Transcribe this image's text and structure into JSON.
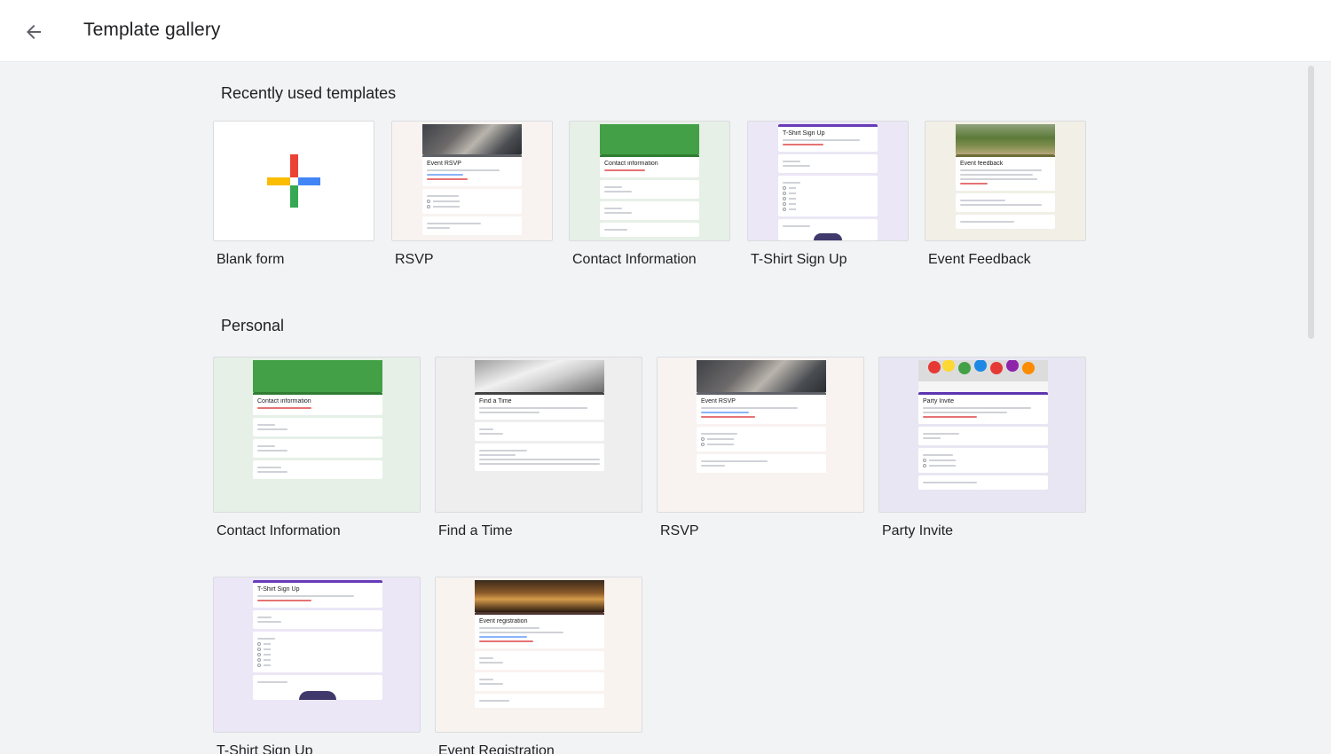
{
  "header": {
    "title": "Template gallery",
    "back_icon": "arrow-back-icon"
  },
  "sections": [
    {
      "title": "Recently used templates",
      "templates": [
        {
          "label": "Blank form"
        },
        {
          "label": "RSVP",
          "form_title": "Event RSVP"
        },
        {
          "label": "Contact Information",
          "form_title": "Contact information"
        },
        {
          "label": "T-Shirt Sign Up",
          "form_title": "T-Shirt Sign Up"
        },
        {
          "label": "Event Feedback",
          "form_title": "Event feedback"
        }
      ]
    },
    {
      "title": "Personal",
      "templates": [
        {
          "label": "Contact Information",
          "form_title": "Contact information"
        },
        {
          "label": "Find a Time",
          "form_title": "Find a Time"
        },
        {
          "label": "RSVP",
          "form_title": "Event RSVP"
        },
        {
          "label": "Party Invite",
          "form_title": "Party Invite"
        },
        {
          "label": "T-Shirt Sign Up",
          "form_title": "T-Shirt Sign Up"
        },
        {
          "label": "Event Registration",
          "form_title": "Event registration"
        }
      ]
    }
  ],
  "colors": {
    "background": "#f1f3f4",
    "header_bg": "#ffffff",
    "form_purple": "#673ab7",
    "form_green": "#43a047",
    "plus_red": "#ea4335",
    "plus_blue": "#4285f4",
    "plus_green": "#34a853",
    "plus_yellow": "#fbbc04"
  }
}
